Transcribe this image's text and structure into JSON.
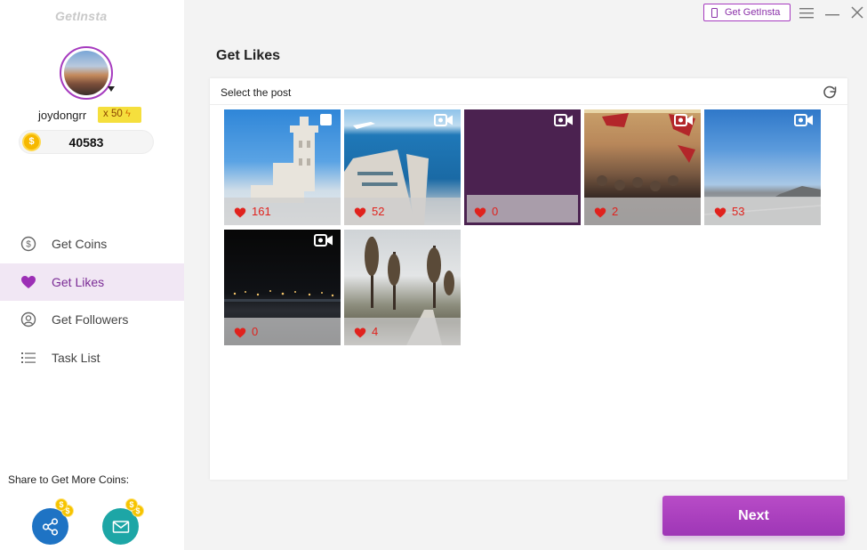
{
  "app": {
    "logo": "GetInsta"
  },
  "profile": {
    "username": "joydongrr",
    "level_badge": "x 50",
    "coins": "40583"
  },
  "nav": {
    "items": [
      {
        "label": "Get Coins",
        "icon": "coin-circle-icon",
        "active": false
      },
      {
        "label": "Get Likes",
        "icon": "heart-icon",
        "active": true
      },
      {
        "label": "Get Followers",
        "icon": "user-circle-icon",
        "active": false
      },
      {
        "label": "Task List",
        "icon": "list-icon",
        "active": false
      }
    ]
  },
  "share": {
    "title": "Share to Get More Coins:",
    "buttons": [
      {
        "icon": "share-icon",
        "color": "#1e73c4"
      },
      {
        "icon": "mail-icon",
        "color": "#1da6a6"
      }
    ]
  },
  "topbar": {
    "get_app_label": "Get GetInsta",
    "icons": [
      "menu-icon",
      "minimize-icon",
      "close-icon"
    ]
  },
  "main": {
    "title": "Get Likes",
    "panel_title": "Select the post",
    "posts": [
      {
        "likes": "161",
        "media": "multi-photo",
        "selected": false
      },
      {
        "likes": "52",
        "media": "video",
        "selected": false
      },
      {
        "likes": "0",
        "media": "video",
        "selected": true
      },
      {
        "likes": "2",
        "media": "video",
        "selected": false
      },
      {
        "likes": "53",
        "media": "video",
        "selected": false
      },
      {
        "likes": "0",
        "media": "video",
        "selected": false
      },
      {
        "likes": "4",
        "media": "photo",
        "selected": false
      }
    ],
    "next_label": "Next"
  },
  "colors": {
    "accent": "#a63bbf",
    "likes_text": "#e0221d",
    "active_nav_bg": "#f1e7f4"
  }
}
